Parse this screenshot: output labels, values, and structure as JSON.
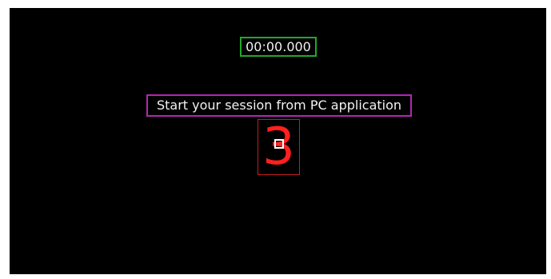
{
  "timer": {
    "value": "00:00.000"
  },
  "message": {
    "text": "Start your session from PC application"
  },
  "countdown": {
    "digit": "3"
  },
  "colors": {
    "screen_background": "#000000",
    "timer_border": "#22a82a",
    "message_border": "#b326b3",
    "countdown_border": "#c51e1e",
    "countdown_text": "#ff1f1f",
    "text": "#f2f2f2"
  }
}
